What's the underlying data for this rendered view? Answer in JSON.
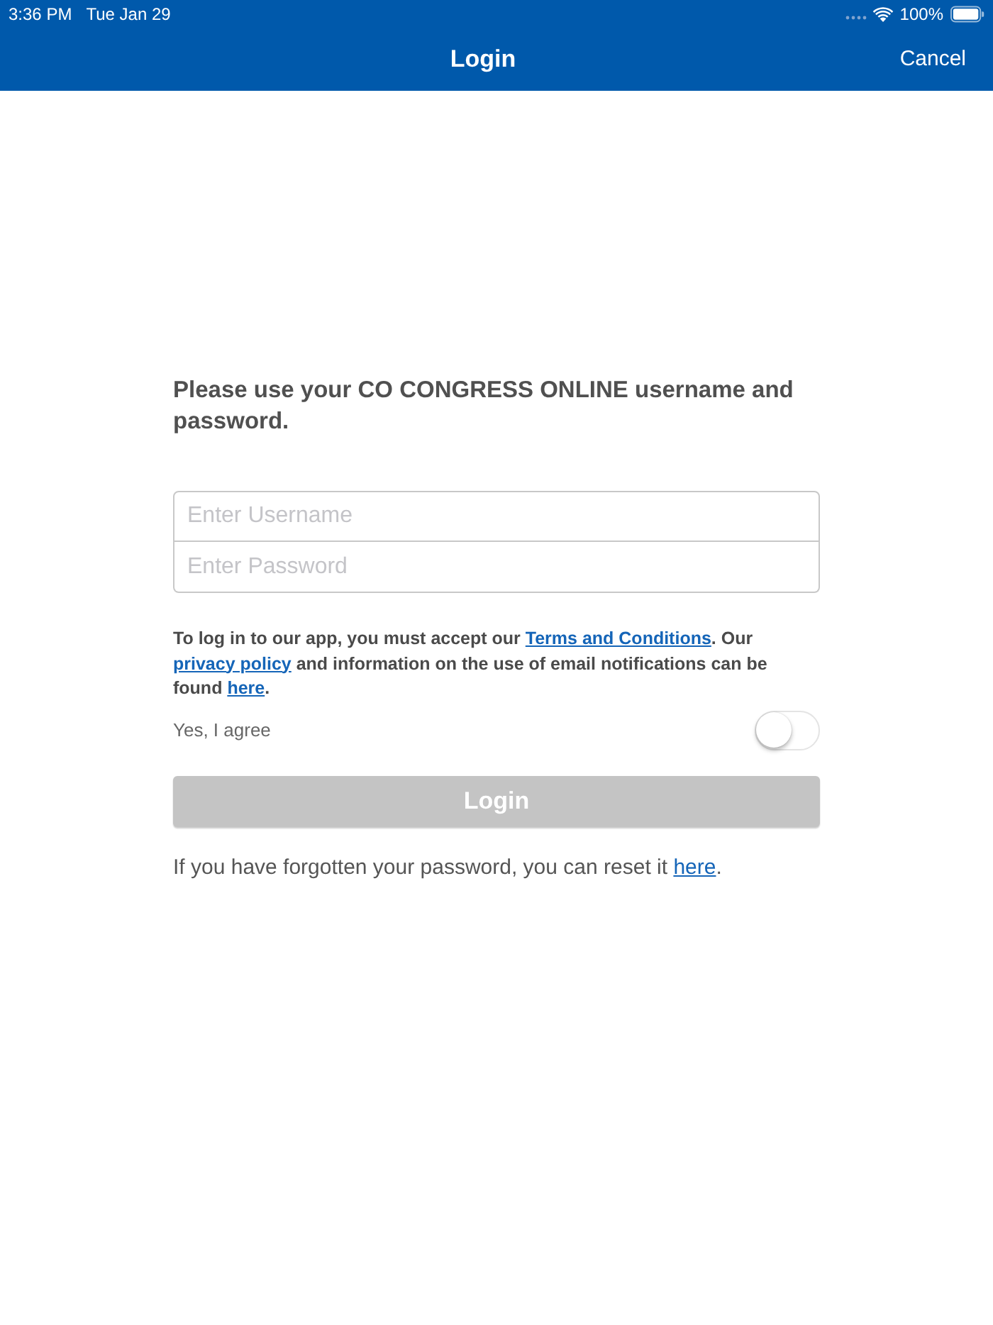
{
  "status_bar": {
    "time": "3:36 PM",
    "date": "Tue Jan 29",
    "battery": "100%"
  },
  "nav_bar": {
    "title": "Login",
    "cancel": "Cancel"
  },
  "intro": "Please use your CO CONGRESS ONLINE username and password.",
  "fields": [
    {
      "placeholder": "Enter Username"
    },
    {
      "placeholder": "Enter Password"
    }
  ],
  "consent": {
    "parts": [
      {
        "kind": "text",
        "text": "To log in to our app, you must accept our "
      },
      {
        "kind": "link",
        "text": "Terms and Conditions"
      },
      {
        "kind": "text",
        "text": ". Our "
      },
      {
        "kind": "link",
        "text": "privacy policy"
      },
      {
        "kind": "text",
        "text": " and information on the use of email notifications can be found "
      },
      {
        "kind": "link",
        "text": "here"
      },
      {
        "kind": "text",
        "text": "."
      }
    ],
    "agree": {
      "label": "Yes, I agree",
      "on": false
    }
  },
  "login_button": {
    "label": "Login",
    "disabled": true
  },
  "reset": {
    "parts": [
      {
        "kind": "text",
        "text": "If you have forgotten your password, you can reset it "
      },
      {
        "kind": "link",
        "text": "here"
      },
      {
        "kind": "text",
        "text": "."
      }
    ]
  }
}
